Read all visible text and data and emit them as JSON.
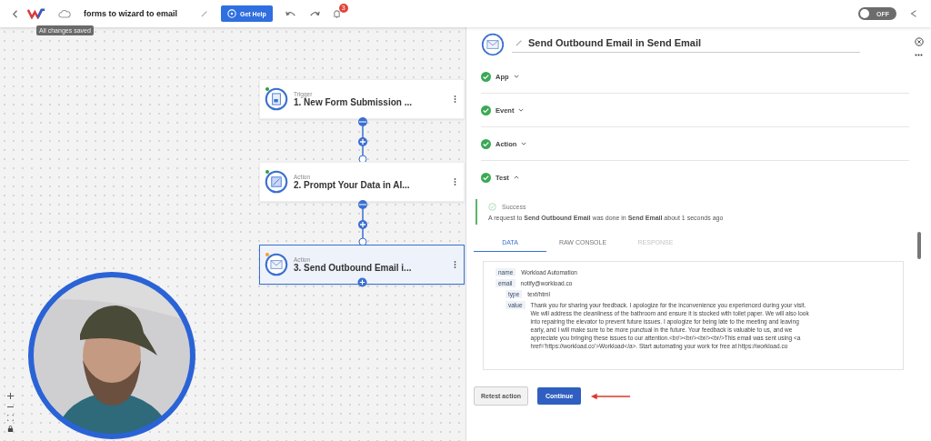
{
  "topbar": {
    "title": "forms to wizard to email",
    "tooltip": "All changes saved",
    "help_button": "Get Help",
    "notification_count": "3",
    "toggle": {
      "label": "OFF",
      "on": false
    }
  },
  "nodes": [
    {
      "type_label": "Trigger",
      "title": "1. New Form Submission ...",
      "color": "#2e9e3e",
      "selected": false
    },
    {
      "type_label": "Action",
      "title": "2. Prompt Your Data in AI...",
      "color": "#2e9e3e",
      "selected": false
    },
    {
      "type_label": "Action",
      "title": "3. Send Outbound Email i...",
      "color": "#f0a030",
      "selected": true
    }
  ],
  "panel": {
    "title": "Send Outbound Email in Send Email",
    "sections": [
      {
        "label": "App",
        "done": true,
        "expanded": false
      },
      {
        "label": "Event",
        "done": true,
        "expanded": false
      },
      {
        "label": "Action",
        "done": true,
        "expanded": false
      },
      {
        "label": "Test",
        "done": true,
        "expanded": true
      }
    ],
    "result": {
      "status": "Success",
      "message": "A request to **Send Outbound Email** was done in **Send Email** about 1 seconds ago"
    },
    "tabs": [
      {
        "label": "DATA",
        "selected": true,
        "disabled": false
      },
      {
        "label": "RAW CONSOLE",
        "selected": false,
        "disabled": false
      },
      {
        "label": "RESPONSE",
        "selected": false,
        "disabled": true
      }
    ],
    "data_groups": [
      {
        "fields": [
          {
            "key": "name",
            "value": "Workload Automation"
          },
          {
            "key": "email",
            "value": "notify@workload.co"
          }
        ]
      },
      {
        "fields": [
          {
            "key": "type",
            "value": "text/html"
          },
          {
            "key": "value",
            "value": "Thank you for sharing your feedback. I apologize for the inconvenience you experienced during your visit. We will address the cleanliness of the bathroom and ensure it is stocked with toilet paper. We will also look into repairing the elevator to prevent future issues. I apologize for being late to the meeting and leaving early, and I will make sure to be more punctual in the future. Your feedback is valuable to us, and we appreciate you bringing these issues to our attention.<br/><br/><br/><br/>This email was sent using <a href='https://workload.co'>Workload</a>. Start automating your work for free at https://workload.co"
          }
        ]
      }
    ],
    "buttons": [
      {
        "label": "Retest action",
        "kind": "secondary"
      },
      {
        "label": "Continue",
        "kind": "primary"
      }
    ]
  }
}
